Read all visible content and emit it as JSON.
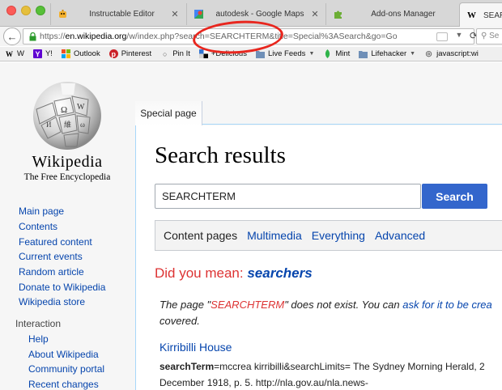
{
  "browser": {
    "tabs": [
      {
        "label": "Instructable Editor",
        "icon": "instructables-robot-icon",
        "close": "✕"
      },
      {
        "label": "autodesk - Google Maps",
        "icon": "google-maps-pin-icon",
        "close": "✕"
      },
      {
        "label": "Add-ons Manager",
        "icon": "puzzle-piece-icon",
        "close": ""
      },
      {
        "label": "SEAR",
        "icon": "wikipedia-w-icon",
        "close": ""
      }
    ],
    "url": {
      "scheme": "https://",
      "host": "en.wikipedia.org",
      "path": "/w/index.php?search=SEARCHTERM&title=Special%3ASearch&go=Go"
    },
    "search_placeholder": "Se"
  },
  "bookmarks": [
    {
      "label": "W",
      "icon": "wikipedia-w-icon"
    },
    {
      "label": "Y!",
      "icon": "yahoo-icon"
    },
    {
      "label": "Outlook",
      "icon": "outlook-icon"
    },
    {
      "label": "Pinterest",
      "icon": "pinterest-icon"
    },
    {
      "label": "Pin It",
      "icon": "pin-it-icon"
    },
    {
      "label": "+Delicious",
      "icon": "delicious-icon"
    },
    {
      "label": "Live Feeds",
      "icon": "folder-icon",
      "dropdown": true
    },
    {
      "label": "Mint",
      "icon": "mint-leaf-icon"
    },
    {
      "label": "Lifehacker",
      "icon": "folder-icon",
      "dropdown": true
    },
    {
      "label": "javascript:wi",
      "icon": "bookmarklet-icon"
    }
  ],
  "wiki": {
    "wordmark": "Wikipedia",
    "tagline": "The Free Encyclopedia",
    "nav": [
      "Main page",
      "Contents",
      "Featured content",
      "Current events",
      "Random article",
      "Donate to Wikipedia",
      "Wikipedia store"
    ],
    "interaction_heading": "Interaction",
    "interaction": [
      "Help",
      "About Wikipedia",
      "Community portal",
      "Recent changes"
    ],
    "tab_label": "Special page",
    "title": "Search results",
    "search_value": "SEARCHTERM",
    "search_button": "Search",
    "profiles": {
      "current": "Content pages",
      "links": [
        "Multimedia",
        "Everything",
        "Advanced"
      ]
    },
    "didyoumean": {
      "prefix": "Did you mean: ",
      "suggestion": "searchers"
    },
    "notexist": {
      "line1_a": "The page \"",
      "term": "SEARCHTERM",
      "line1_b": "\" does not exist. You can ",
      "ask": "ask for it to be crea",
      "line2": "covered."
    },
    "result": {
      "title": "Kirribilli House",
      "snippet_bold": "searchTerm",
      "snippet_line1": "=mccrea kirribilli&searchLimits= The Sydney Morning Herald, 2",
      "snippet_line2": "December 1918, p. 5. http://nla.gov.au/nla.news-"
    }
  },
  "colors": {
    "link": "#0645ad",
    "red": "#dd3333",
    "button": "#3366cc",
    "annotation": "#e8261e"
  }
}
